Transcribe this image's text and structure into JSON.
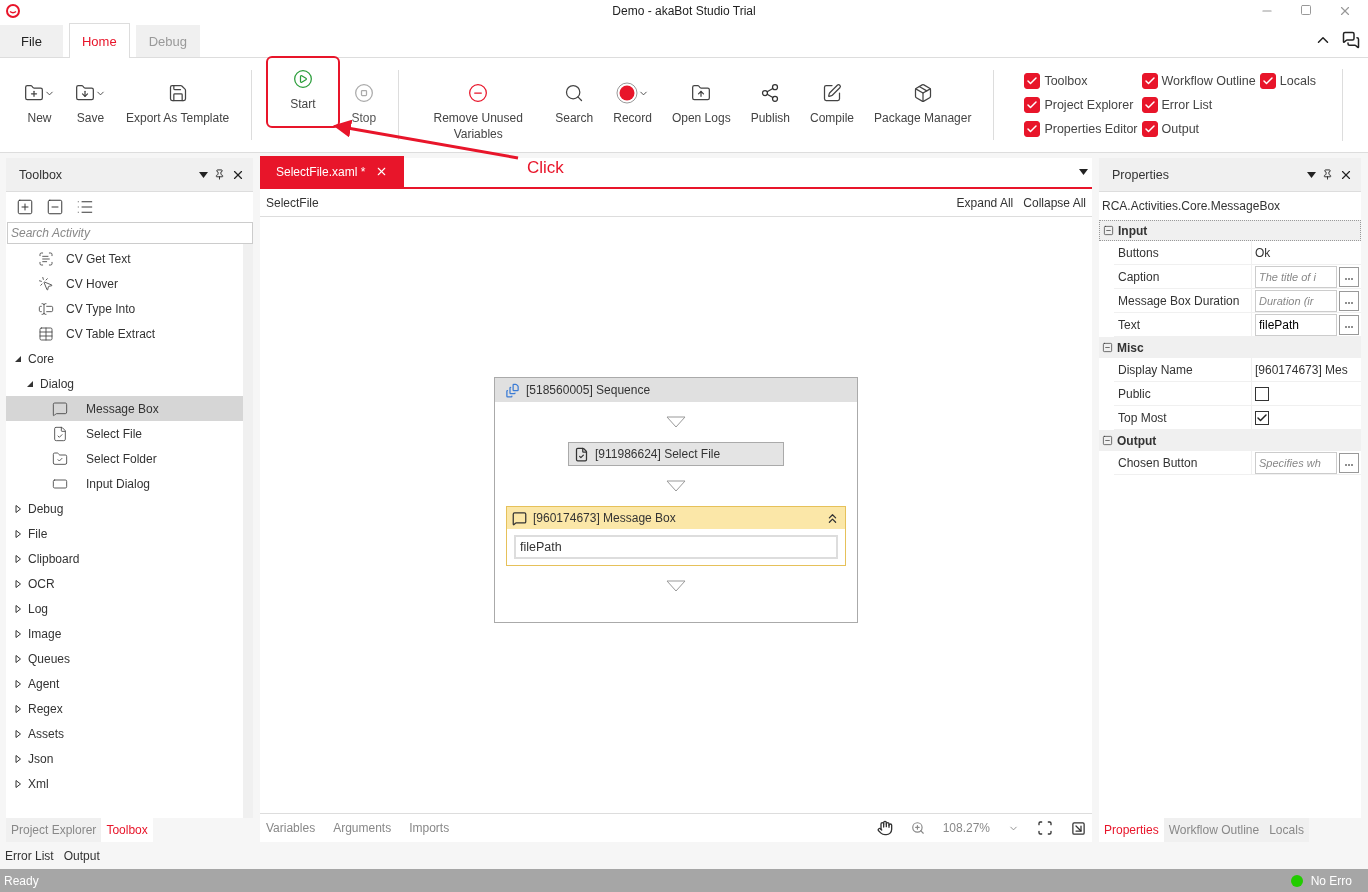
{
  "window": {
    "title": "Demo - akaBot Studio Trial"
  },
  "menu_tabs": [
    {
      "label": "File",
      "kind": "file",
      "selected": false
    },
    {
      "label": "Home",
      "kind": "tab",
      "selected": true
    },
    {
      "label": "Debug",
      "kind": "tab",
      "selected": false
    }
  ],
  "ribbon": {
    "groups": [
      [
        {
          "label": "New",
          "kind": "new",
          "dropdown": true,
          "disabled": false,
          "highlighted": false
        },
        {
          "label": "Save",
          "kind": "save",
          "dropdown": true,
          "disabled": false,
          "highlighted": false
        },
        {
          "label": "Export As Template",
          "kind": "export",
          "dropdown": false,
          "disabled": false,
          "highlighted": false
        }
      ],
      [
        {
          "label": "Start",
          "kind": "start",
          "dropdown": false,
          "disabled": false,
          "highlighted": true
        },
        {
          "label": "Stop",
          "kind": "stop",
          "dropdown": false,
          "disabled": true,
          "highlighted": false
        }
      ],
      [
        {
          "label": "Remove Unused Variables",
          "kind": "remove",
          "dropdown": false,
          "disabled": false,
          "highlighted": false
        },
        {
          "label": "Search",
          "kind": "search",
          "dropdown": false,
          "disabled": false,
          "highlighted": false
        },
        {
          "label": "Record",
          "kind": "record",
          "dropdown": true,
          "disabled": false,
          "highlighted": false
        },
        {
          "label": "Open Logs",
          "kind": "logs",
          "dropdown": false,
          "disabled": false,
          "highlighted": false
        },
        {
          "label": "Publish",
          "kind": "publish",
          "dropdown": false,
          "disabled": false,
          "highlighted": false
        },
        {
          "label": "Compile",
          "kind": "compile",
          "dropdown": false,
          "disabled": false,
          "highlighted": false
        },
        {
          "label": "Package Manager",
          "kind": "package",
          "dropdown": false,
          "disabled": false,
          "highlighted": false
        }
      ]
    ],
    "panels": [
      {
        "label": "Toolbox",
        "checked": true
      },
      {
        "label": "Project Explorer",
        "checked": true
      },
      {
        "label": "Properties Editor",
        "checked": true
      },
      {
        "label": "Workflow Outline",
        "checked": true
      },
      {
        "label": "Error List",
        "checked": true
      },
      {
        "label": "Output",
        "checked": true
      },
      {
        "label": "Locals",
        "checked": true
      }
    ]
  },
  "annotation": {
    "label": "Click"
  },
  "toolbox": {
    "title": "Toolbox",
    "search": {
      "placeholder": "Search Activity"
    },
    "tree": [
      {
        "children": [
          {
            "label": "CV Get Text",
            "kind": "gettext"
          },
          {
            "label": "CV Hover",
            "kind": "hover"
          },
          {
            "label": "CV Type Into",
            "kind": "typeinto"
          },
          {
            "label": "CV Table Extract",
            "kind": "table"
          }
        ]
      },
      {
        "label": "Core",
        "expanded": true,
        "children": [
          {
            "label": "Dialog",
            "expanded": true,
            "children": [
              {
                "label": "Message Box",
                "kind": "message",
                "selected": true
              },
              {
                "label": "Select File",
                "kind": "file",
                "selected": false
              },
              {
                "label": "Select Folder",
                "kind": "folder",
                "selected": false
              },
              {
                "label": "Input Dialog",
                "kind": "input",
                "selected": false
              }
            ]
          }
        ]
      },
      {
        "label": "Debug",
        "expanded": false
      },
      {
        "label": "File",
        "expanded": false
      },
      {
        "label": "Clipboard",
        "expanded": false
      },
      {
        "label": "OCR",
        "expanded": false
      },
      {
        "label": "Log",
        "expanded": false
      },
      {
        "label": "Image",
        "expanded": false
      },
      {
        "label": "Queues",
        "expanded": false
      },
      {
        "label": "Agent",
        "expanded": false
      },
      {
        "label": "Regex",
        "expanded": false
      },
      {
        "label": "Assets",
        "expanded": false
      },
      {
        "label": "Json",
        "expanded": false
      },
      {
        "label": "Xml",
        "expanded": false
      }
    ],
    "bottom_tabs": [
      {
        "label": "Project Explorer",
        "selected": false
      },
      {
        "label": "Toolbox",
        "selected": true
      }
    ]
  },
  "designer": {
    "doc_tab": "SelectFile.xaml *",
    "breadcrumb": "SelectFile",
    "actions": [
      "Expand All",
      "Collapse All"
    ],
    "sequence": {
      "title": "[518560005] Sequence",
      "activities": [
        {
          "kind": "select_file",
          "title": "[911986624] Select File",
          "selected": false
        },
        {
          "kind": "message_box",
          "title": "[960174673] Message Box",
          "selected": true,
          "expression": "filePath"
        }
      ]
    },
    "bottom_links": [
      "Variables",
      "Arguments",
      "Imports"
    ],
    "zoom": "108.27%"
  },
  "properties": {
    "title": "Properties",
    "type_name": "RCA.Activities.Core.MessageBox",
    "categories": [
      {
        "name": "Input",
        "expanded": true,
        "rows": [
          {
            "name": "Buttons",
            "kind": "text",
            "value": "Ok"
          },
          {
            "name": "Caption",
            "kind": "field",
            "placeholder": "The title of i"
          },
          {
            "name": "Message Box Duration",
            "kind": "field",
            "placeholder": "Duration (ir"
          },
          {
            "name": "Text",
            "kind": "field",
            "value": "filePath"
          }
        ]
      },
      {
        "name": "Misc",
        "expanded": true,
        "rows": [
          {
            "name": "Display Name",
            "kind": "text",
            "value": "[960174673] Mes"
          },
          {
            "name": "Public",
            "kind": "checkbox",
            "checked": false
          },
          {
            "name": "Top Most",
            "kind": "checkbox",
            "checked": true
          }
        ]
      },
      {
        "name": "Output",
        "expanded": true,
        "rows": [
          {
            "name": "Chosen Button",
            "kind": "field",
            "placeholder": "Specifies wh"
          }
        ]
      }
    ],
    "bottom_tabs": [
      {
        "label": "Properties",
        "selected": true
      },
      {
        "label": "Workflow Outline",
        "selected": false
      },
      {
        "label": "Locals",
        "selected": false
      }
    ]
  },
  "bottom_tabs": [
    {
      "label": "Error List",
      "selected": false
    },
    {
      "label": "Output",
      "selected": false
    }
  ],
  "status_bar": {
    "text": "Ready",
    "indicator": {
      "label": "No Erro",
      "color": "#22cc00"
    }
  }
}
